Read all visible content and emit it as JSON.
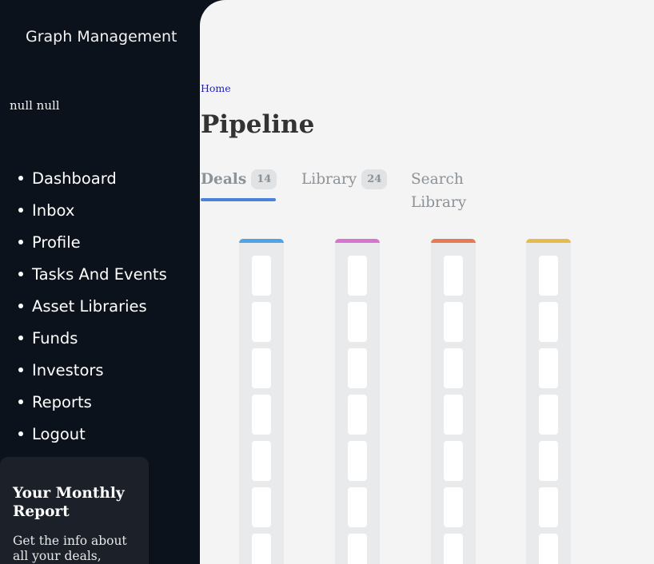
{
  "app": {
    "title": "Graph Management"
  },
  "user": {
    "name": "null null"
  },
  "sidebar": {
    "items": [
      {
        "label": "Dashboard"
      },
      {
        "label": "Inbox"
      },
      {
        "label": "Profile"
      },
      {
        "label": "Tasks And Events"
      },
      {
        "label": "Asset Libraries"
      },
      {
        "label": "Funds"
      },
      {
        "label": "Investors"
      },
      {
        "label": "Reports"
      },
      {
        "label": "Logout"
      }
    ],
    "report_card": {
      "title": "Your Monthly Report",
      "description": "Get the info about all your deals,"
    }
  },
  "breadcrumb": {
    "home": "Home"
  },
  "page": {
    "title": "Pipeline"
  },
  "tabs": [
    {
      "label": "Deals",
      "count": "14",
      "active": true
    },
    {
      "label": "Library",
      "count": "24",
      "active": false
    },
    {
      "label": "Search Library",
      "active": false
    }
  ],
  "colors": {
    "sidebar_bg": "#0c121b",
    "main_bg": "#f4f4f4",
    "accent": "#4a82d9",
    "column_1": "#4fa3e3",
    "column_2": "#d674d0",
    "column_3": "#e57a55",
    "column_4": "#e6bb4c"
  },
  "board": {
    "columns": [
      {
        "color": "#4fa3e3",
        "card_count": 7
      },
      {
        "color": "#d674d0",
        "card_count": 7
      },
      {
        "color": "#e57a55",
        "card_count": 7
      },
      {
        "color": "#e6bb4c",
        "card_count": 7
      }
    ]
  }
}
